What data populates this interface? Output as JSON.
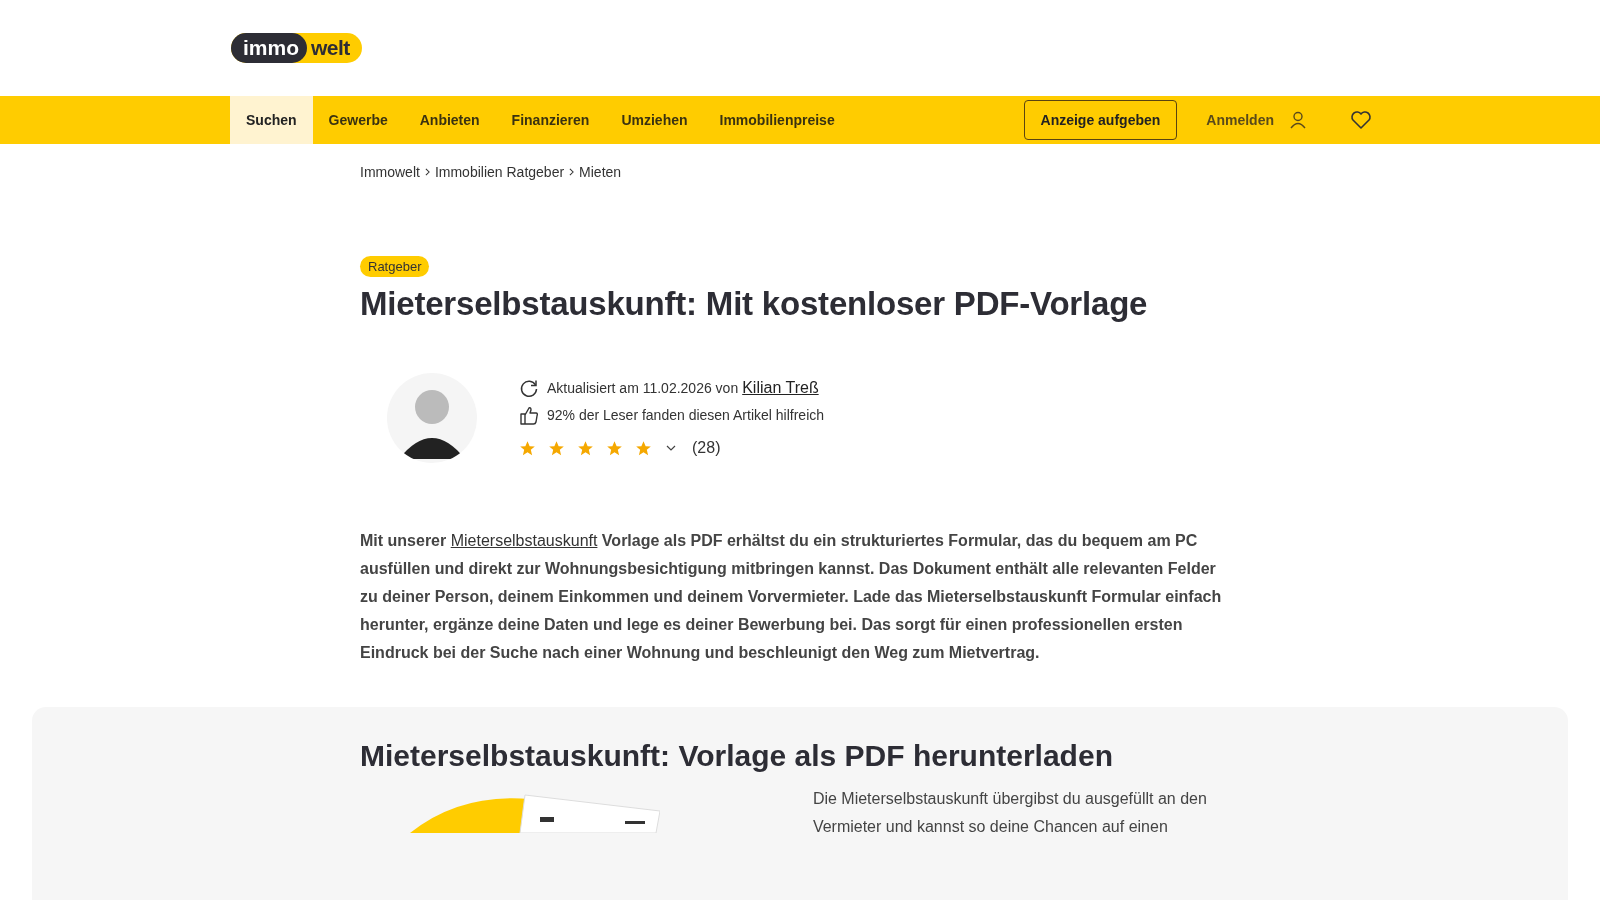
{
  "header": {
    "logo": {
      "left": "immo",
      "right": "welt"
    }
  },
  "nav": {
    "items": [
      {
        "label": "Suchen",
        "selected": true
      },
      {
        "label": "Gewerbe",
        "selected": false
      },
      {
        "label": "Anbieten",
        "selected": false
      },
      {
        "label": "Finanzieren",
        "selected": false
      },
      {
        "label": "Umziehen",
        "selected": false
      },
      {
        "label": "Immobilienpreise",
        "selected": false
      }
    ],
    "cta": "Anzeige aufgeben",
    "login": "Anmelden"
  },
  "breadcrumb": [
    "Immowelt",
    "Immobilien Ratgeber",
    "Mieten"
  ],
  "badge": "Ratgeber",
  "title": "Mieterselbstauskunft: Mit kostenloser PDF-Vorlage",
  "meta": {
    "updated": "Aktualisiert am 11.02.2026 von",
    "author": "Kilian Treß",
    "helpful": "92% der Leser fanden diesen Artikel hilfreich",
    "stars": 5,
    "count": "(28)"
  },
  "intro": {
    "before": "Mit unserer",
    "link": "Mieterselbstauskunft",
    "after": "Vorlage als PDF erhältst du ein strukturiertes Formular, das du bequem am PC ausfüllen und direkt zur Wohnungsbesichtigung mitbringen kannst. Das Dokument enthält alle relevanten Felder zu deiner Person, deinem Einkommen und deinem Vorvermieter. Lade das Mieterselbstauskunft Formular einfach herunter, ergänze deine Daten und lege es deiner Bewerbung bei. Das sorgt für einen professionellen ersten Eindruck bei der Suche nach einer Wohnung und beschleunigt den Weg zum Mietvertrag."
  },
  "download": {
    "title": "Mieterselbstauskunft: Vorlage als PDF herunterladen",
    "text": "Die Mieterselbstauskunft übergibst du ausgefüllt an den Vermieter und kannst so deine Chancen auf einen"
  }
}
